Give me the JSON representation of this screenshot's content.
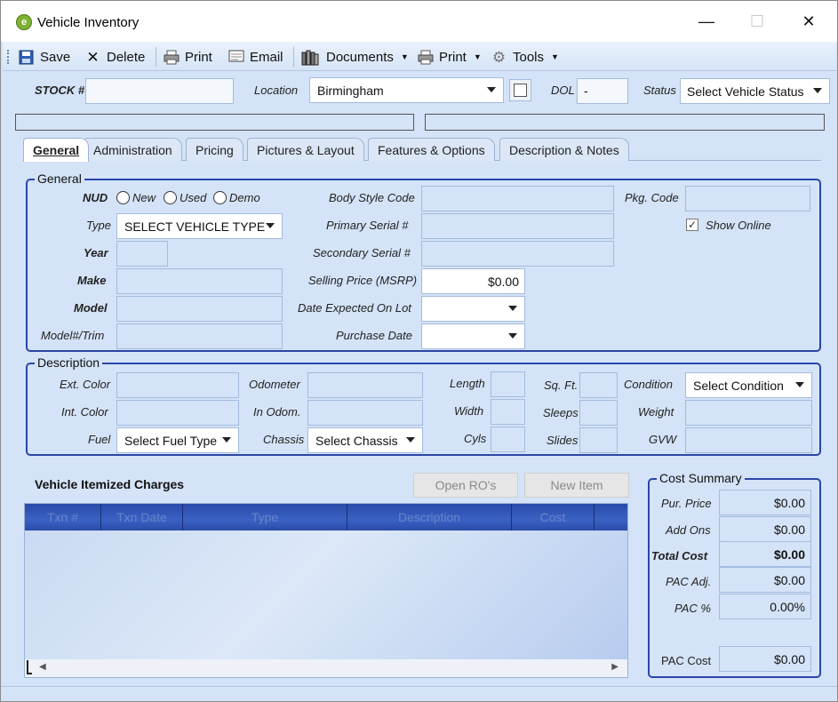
{
  "window": {
    "title": "Vehicle Inventory",
    "minimize": "—",
    "maximize": "☐",
    "close": "✕"
  },
  "toolbar": {
    "save": "Save",
    "delete": "Delete",
    "print": "Print",
    "email": "Email",
    "documents": "Documents",
    "print2": "Print",
    "tools": "Tools"
  },
  "header": {
    "stock_label": "STOCK #",
    "stock_value": "",
    "location_label": "Location",
    "location_value": "Birmingham",
    "dol_label": "DOL",
    "dol_value": "-",
    "status_label": "Status",
    "status_value": "Select Vehicle Status"
  },
  "tabs": [
    "General",
    "Administration",
    "Pricing",
    "Pictures & Layout",
    "Features & Options",
    "Description & Notes"
  ],
  "general": {
    "title": "General",
    "nud_label": "NUD",
    "nud_options": [
      "New",
      "Used",
      "Demo"
    ],
    "type_label": "Type",
    "type_value": "SELECT VEHICLE TYPE",
    "year_label": "Year",
    "make_label": "Make",
    "model_label": "Model",
    "trim_label": "Model#/Trim",
    "body_style_label": "Body Style Code",
    "primary_serial_label": "Primary Serial #",
    "secondary_serial_label": "Secondary Serial #",
    "msrp_label": "Selling Price (MSRP)",
    "msrp_value": "$0.00",
    "date_expected_label": "Date Expected On Lot",
    "purchase_date_label": "Purchase Date",
    "pkg_code_label": "Pkg. Code",
    "show_online_label": "Show Online",
    "show_online_checked": true
  },
  "description": {
    "title": "Description",
    "ext_color_label": "Ext. Color",
    "int_color_label": "Int. Color",
    "fuel_label": "Fuel",
    "fuel_value": "Select Fuel Type",
    "odometer_label": "Odometer",
    "in_odom_label": "In Odom.",
    "chassis_label": "Chassis",
    "chassis_value": "Select Chassis",
    "length_label": "Length",
    "width_label": "Width",
    "cyls_label": "Cyls",
    "sqft_label": "Sq. Ft.",
    "sleeps_label": "Sleeps",
    "slides_label": "Slides",
    "condition_label": "Condition",
    "condition_value": "Select Condition",
    "weight_label": "Weight",
    "gvw_label": "GVW"
  },
  "charges": {
    "title": "Vehicle Itemized Charges",
    "open_ros": "Open RO's",
    "new_item": "New Item",
    "columns": [
      "Txn #",
      "Txn Date",
      "Type",
      "Description",
      "Cost"
    ]
  },
  "cost_summary": {
    "title": "Cost Summary",
    "rows": [
      {
        "label": "Pur. Price",
        "value": "$0.00"
      },
      {
        "label": "Add Ons",
        "value": "$0.00"
      },
      {
        "label": "Total Cost",
        "value": "$0.00"
      },
      {
        "label": "PAC Adj.",
        "value": "$0.00"
      },
      {
        "label": "PAC %",
        "value": "0.00%"
      }
    ],
    "pac_cost_label": "PAC Cost",
    "pac_cost_value": "$0.00"
  },
  "colors": {
    "accent": "#2b46a6",
    "panel_bg": "#d4e3f7",
    "grid_header": "#2a4aa8"
  },
  "icons": [
    "app-logo-icon",
    "save-icon",
    "delete-icon",
    "print-icon",
    "email-icon",
    "documents-icon",
    "tools-gear-icon",
    "location-lookup-icon"
  ]
}
